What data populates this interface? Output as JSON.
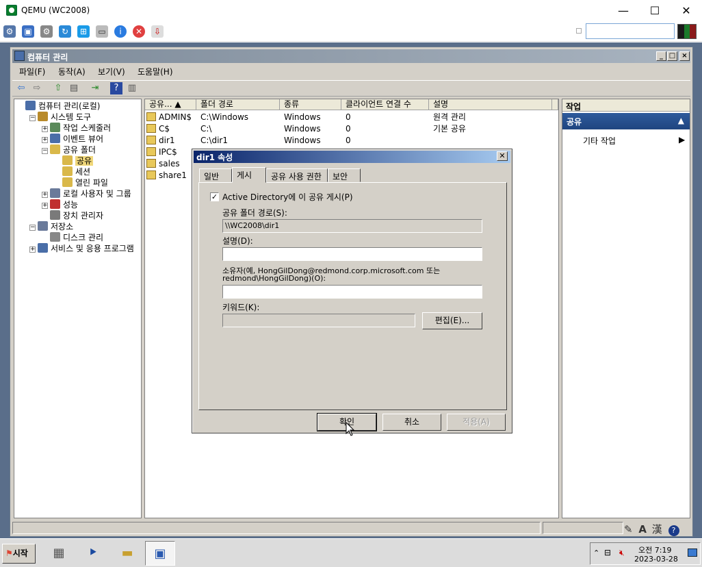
{
  "qemu": {
    "title": "QEMU (WC2008)",
    "minimize": "—",
    "maximize": "☐",
    "close": "✕"
  },
  "cm": {
    "title": "컴퓨터 관리",
    "menu": [
      "파일(F)",
      "동작(A)",
      "보기(V)",
      "도움말(H)"
    ],
    "tree": [
      {
        "label": "컴퓨터 관리(로컬)",
        "level": 0,
        "exp": ""
      },
      {
        "label": "시스템 도구",
        "level": 1,
        "exp": "−"
      },
      {
        "label": "작업 스케줄러",
        "level": 2,
        "exp": "+"
      },
      {
        "label": "이벤트 뷰어",
        "level": 2,
        "exp": "+"
      },
      {
        "label": "공유 폴더",
        "level": 2,
        "exp": "−"
      },
      {
        "label": "공유",
        "level": 3,
        "exp": ""
      },
      {
        "label": "세션",
        "level": 3,
        "exp": ""
      },
      {
        "label": "열린 파일",
        "level": 3,
        "exp": ""
      },
      {
        "label": "로컬 사용자 및 그룹",
        "level": 2,
        "exp": "+"
      },
      {
        "label": "성능",
        "level": 2,
        "exp": "+"
      },
      {
        "label": "장치 관리자",
        "level": 2,
        "exp": ""
      },
      {
        "label": "저장소",
        "level": 1,
        "exp": "−"
      },
      {
        "label": "디스크 관리",
        "level": 2,
        "exp": ""
      },
      {
        "label": "서비스 및 응용 프로그램",
        "level": 1,
        "exp": "+"
      }
    ],
    "columns": [
      "공유...",
      "폴더 경로",
      "종류",
      "클라이언트 연결 수",
      "설명"
    ],
    "rows": [
      [
        "ADMIN$",
        "C:\\Windows",
        "Windows",
        "0",
        "원격 관리"
      ],
      [
        "C$",
        "C:\\",
        "Windows",
        "0",
        "기본 공유"
      ],
      [
        "dir1",
        "C:\\dir1",
        "Windows",
        "0",
        ""
      ],
      [
        "IPC$",
        "",
        "",
        "",
        ""
      ],
      [
        "sales",
        "",
        "",
        "",
        ""
      ],
      [
        "share1",
        "",
        "",
        "",
        ""
      ]
    ],
    "actions": {
      "header": "작업",
      "selected": "공유",
      "more": "기타 작업"
    }
  },
  "dialog": {
    "title": "dir1 속성",
    "close": "✕",
    "tabs": [
      "일반",
      "게시",
      "공유 사용 권한",
      "보안"
    ],
    "publish_label": "Active Directory에 이 공유 게시(P)",
    "publish_checked": "✓",
    "path_label": "공유 폴더 경로(S):",
    "path_value": "\\\\WC2008\\dir1",
    "desc_label": "설명(D):",
    "desc_value": "",
    "owner_label_1": "소유자(예, HongGilDong@redmond.corp.microsoft.com 또는",
    "owner_label_2": "redmond\\HongGilDong)(O):",
    "owner_value": "",
    "keyword_label": "키워드(K):",
    "keyword_value": "",
    "edit_button": "편집(E)...",
    "ok": "확인",
    "cancel": "취소",
    "apply": "적용(A)"
  },
  "taskbar": {
    "start": "시작",
    "time": "오전 7:19",
    "date": "2023-03-28"
  }
}
